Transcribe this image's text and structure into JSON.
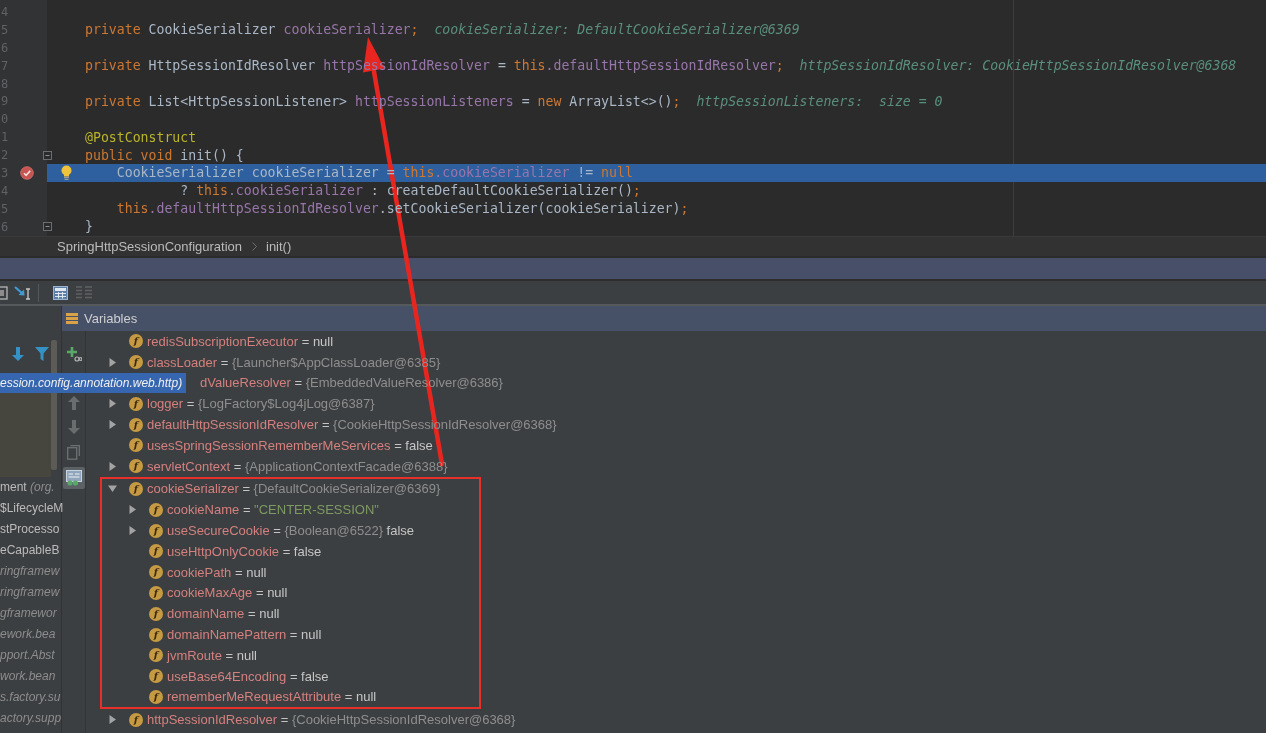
{
  "code_lines": [
    {
      "number": "4",
      "current": false,
      "breakpoint": false,
      "bulb": false,
      "fold": false
    },
    {
      "number": "5",
      "kind": "member",
      "current": false,
      "breakpoint": false,
      "bulb": false,
      "fold": false,
      "tokens": [
        {
          "text": "private",
          "kind": "keyword"
        },
        {
          "text": " CookieSerializer ",
          "kind": "plain"
        },
        {
          "text": "cookieSerializer",
          "kind": "field"
        },
        {
          "text": ";",
          "kind": "keyword"
        }
      ],
      "hint": "cookieSerializer: DefaultCookieSerializer@6369"
    },
    {
      "number": "6",
      "current": false,
      "breakpoint": false,
      "bulb": false,
      "fold": false
    },
    {
      "number": "7",
      "kind": "member",
      "current": false,
      "breakpoint": false,
      "bulb": false,
      "fold": false,
      "tokens": [
        {
          "text": "private",
          "kind": "keyword"
        },
        {
          "text": " HttpSessionIdResolver ",
          "kind": "plain"
        },
        {
          "text": "httpSessionIdResolver",
          "kind": "field"
        },
        {
          "text": " = ",
          "kind": "plain"
        },
        {
          "text": "this",
          "kind": "keyword"
        },
        {
          "text": ".defaultHttpSessionIdResolver",
          "kind": "field"
        },
        {
          "text": ";",
          "kind": "keyword"
        }
      ],
      "hint": "httpSessionIdResolver: CookieHttpSessionIdResolver@6368"
    },
    {
      "number": "8",
      "current": false,
      "breakpoint": false,
      "bulb": false,
      "fold": false
    },
    {
      "number": "9",
      "kind": "member",
      "current": false,
      "breakpoint": false,
      "bulb": false,
      "fold": false,
      "tokens": [
        {
          "text": "private",
          "kind": "keyword"
        },
        {
          "text": " List<HttpSessionListener> ",
          "kind": "plain"
        },
        {
          "text": "httpSessionListeners",
          "kind": "field"
        },
        {
          "text": " = ",
          "kind": "plain"
        },
        {
          "text": "new",
          "kind": "keyword"
        },
        {
          "text": " ArrayList<>()",
          "kind": "plain"
        },
        {
          "text": ";",
          "kind": "keyword"
        }
      ],
      "hint": "httpSessionListeners:  size = 0"
    },
    {
      "number": "0",
      "current": false,
      "breakpoint": false,
      "bulb": false,
      "fold": false
    },
    {
      "number": "1",
      "kind": "member",
      "current": false,
      "breakpoint": false,
      "bulb": false,
      "fold": false,
      "tokens": [
        {
          "text": "@PostConstruct",
          "kind": "annotation"
        }
      ]
    },
    {
      "number": "2",
      "kind": "member",
      "current": false,
      "breakpoint": false,
      "bulb": false,
      "fold": true,
      "tokens": [
        {
          "text": "public void",
          "kind": "keyword"
        },
        {
          "text": " init() {",
          "kind": "plain"
        }
      ]
    },
    {
      "number": "3",
      "kind": "statement",
      "current": true,
      "breakpoint": true,
      "bulb": true,
      "fold": false,
      "tokens": [
        {
          "text": "CookieSerializer cookieSerializer = ",
          "kind": "plain"
        },
        {
          "text": "this",
          "kind": "keyword"
        },
        {
          "text": ".cookieSerializer",
          "kind": "field"
        },
        {
          "text": " != ",
          "kind": "plain"
        },
        {
          "text": "null",
          "kind": "keyword"
        }
      ]
    },
    {
      "number": "4",
      "kind": "continuation",
      "current": false,
      "breakpoint": false,
      "bulb": false,
      "fold": false,
      "tokens": [
        {
          "text": "? ",
          "kind": "plain"
        },
        {
          "text": "this",
          "kind": "keyword"
        },
        {
          "text": ".cookieSerializer",
          "kind": "field"
        },
        {
          "text": " : createDefaultCookieSerializer()",
          "kind": "plain"
        },
        {
          "text": ";",
          "kind": "keyword"
        }
      ]
    },
    {
      "number": "5",
      "kind": "statement",
      "current": false,
      "breakpoint": false,
      "bulb": false,
      "fold": false,
      "tokens": [
        {
          "text": "this",
          "kind": "keyword"
        },
        {
          "text": ".defaultHttpSessionIdResolver",
          "kind": "field"
        },
        {
          "text": ".setCookieSerializer(cookieSerializer)",
          "kind": "plain"
        },
        {
          "text": ";",
          "kind": "keyword"
        }
      ]
    },
    {
      "number": "6",
      "kind": "member",
      "current": false,
      "breakpoint": false,
      "bulb": false,
      "fold": true,
      "tokens": [
        {
          "text": "}",
          "kind": "plain"
        }
      ]
    }
  ],
  "breadcrumb": [
    {
      "label": "SpringHttpSessionConfiguration"
    },
    {
      "label": "init()"
    }
  ],
  "debug_toolbar": [
    {
      "disabled": false
    },
    {
      "disabled": false
    },
    {
      "disabled": false
    },
    {
      "disabled": true
    }
  ],
  "variables_panel": {
    "title": "Variables"
  },
  "frames": [
    {
      "selected": true,
      "package": "ession.config.annotation.web.http)"
    },
    {
      "selected": false,
      "name": "ment",
      "package": "(org."
    },
    {
      "selected": false,
      "name": "$LifecycleM"
    },
    {
      "selected": false,
      "name": "stProcesso"
    },
    {
      "selected": false,
      "name": "eCapableB"
    },
    {
      "selected": false,
      "package": "ringframew"
    },
    {
      "selected": false,
      "package": "ringframew"
    },
    {
      "selected": false,
      "package": "gframewor"
    },
    {
      "selected": false,
      "package": "ework.bea"
    },
    {
      "selected": false,
      "package": "pport.Abst"
    },
    {
      "selected": false,
      "package": "work.bean"
    },
    {
      "selected": false,
      "package": "s.factory.su"
    },
    {
      "selected": false,
      "package": "actory.supp"
    }
  ],
  "side_toolbar": [
    {
      "disabled": false,
      "pressed": false
    },
    {
      "disabled": true,
      "pressed": false
    },
    {
      "disabled": true,
      "pressed": false
    },
    {
      "disabled": true,
      "pressed": false
    },
    {
      "disabled": false,
      "pressed": true
    }
  ],
  "variables": [
    {
      "kind": "field",
      "icon_letter": "f",
      "name": "redisSubscriptionExecutor",
      "sep": "=",
      "value": "null"
    },
    {
      "kind": "field",
      "expanded": false,
      "icon_letter": "f",
      "name": "classLoader",
      "sep": "=",
      "ref": "{Launcher$AppClassLoader@6385}"
    },
    {
      "kind": "covered",
      "name": "dValueResolver",
      "sep": "=",
      "ref": "{EmbeddedValueResolver@6386}"
    },
    {
      "kind": "field",
      "expanded": false,
      "icon_letter": "f",
      "name": "logger",
      "sep": "=",
      "ref": "{LogFactory$Log4jLog@6387}"
    },
    {
      "kind": "field",
      "expanded": false,
      "icon_letter": "f",
      "name": "defaultHttpSessionIdResolver",
      "sep": "=",
      "ref": "{CookieHttpSessionIdResolver@6368}"
    },
    {
      "kind": "field",
      "icon_letter": "f",
      "name": "usesSpringSessionRememberMeServices",
      "sep": "=",
      "value": "false"
    },
    {
      "kind": "field",
      "expanded": false,
      "icon_letter": "f",
      "name": "servletContext",
      "sep": "=",
      "ref": "{ApplicationContextFacade@6388}"
    },
    {
      "kind": "field",
      "expanded": true,
      "icon_letter": "f",
      "name": "cookieSerializer",
      "sep": "=",
      "ref": "{DefaultCookieSerializer@6369}",
      "children": [
        {
          "kind": "field",
          "expanded": false,
          "icon_letter": "f",
          "name": "cookieName",
          "sep": "=",
          "string": "\"CENTER-SESSION\""
        },
        {
          "kind": "field",
          "expanded": false,
          "icon_letter": "f",
          "name": "useSecureCookie",
          "sep": "=",
          "ref": "{Boolean@6522}",
          "value": "false"
        },
        {
          "kind": "field",
          "icon_letter": "f",
          "name": "useHttpOnlyCookie",
          "sep": "=",
          "value": "false"
        },
        {
          "kind": "field",
          "icon_letter": "f",
          "name": "cookiePath",
          "sep": "=",
          "value": "null"
        },
        {
          "kind": "field",
          "icon_letter": "f",
          "name": "cookieMaxAge",
          "sep": "=",
          "value": "null"
        },
        {
          "kind": "field",
          "icon_letter": "f",
          "name": "domainName",
          "sep": "=",
          "value": "null"
        },
        {
          "kind": "field",
          "icon_letter": "f",
          "name": "domainNamePattern",
          "sep": "=",
          "value": "null"
        },
        {
          "kind": "field",
          "icon_letter": "f",
          "name": "jvmRoute",
          "sep": "=",
          "value": "null"
        },
        {
          "kind": "field",
          "icon_letter": "f",
          "name": "useBase64Encoding",
          "sep": "=",
          "value": "false"
        },
        {
          "kind": "field",
          "icon_letter": "f",
          "name": "rememberMeRequestAttribute",
          "sep": "=",
          "value": "null"
        }
      ]
    },
    {
      "kind": "field",
      "expanded": false,
      "icon_letter": "f",
      "name": "httpSessionIdResolver",
      "sep": "=",
      "ref": "{CookieHttpSessionIdResolver@6368}"
    }
  ]
}
